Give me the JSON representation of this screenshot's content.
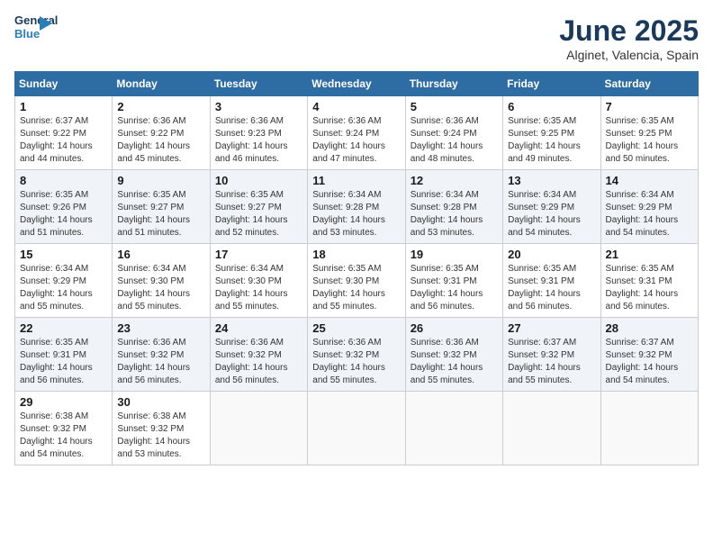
{
  "header": {
    "logo_line1": "General",
    "logo_line2": "Blue",
    "month_title": "June 2025",
    "location": "Alginet, Valencia, Spain"
  },
  "weekdays": [
    "Sunday",
    "Monday",
    "Tuesday",
    "Wednesday",
    "Thursday",
    "Friday",
    "Saturday"
  ],
  "weeks": [
    [
      {
        "day": "1",
        "sunrise": "6:37 AM",
        "sunset": "9:22 PM",
        "daylight": "14 hours and 44 minutes."
      },
      {
        "day": "2",
        "sunrise": "6:36 AM",
        "sunset": "9:22 PM",
        "daylight": "14 hours and 45 minutes."
      },
      {
        "day": "3",
        "sunrise": "6:36 AM",
        "sunset": "9:23 PM",
        "daylight": "14 hours and 46 minutes."
      },
      {
        "day": "4",
        "sunrise": "6:36 AM",
        "sunset": "9:24 PM",
        "daylight": "14 hours and 47 minutes."
      },
      {
        "day": "5",
        "sunrise": "6:36 AM",
        "sunset": "9:24 PM",
        "daylight": "14 hours and 48 minutes."
      },
      {
        "day": "6",
        "sunrise": "6:35 AM",
        "sunset": "9:25 PM",
        "daylight": "14 hours and 49 minutes."
      },
      {
        "day": "7",
        "sunrise": "6:35 AM",
        "sunset": "9:25 PM",
        "daylight": "14 hours and 50 minutes."
      }
    ],
    [
      {
        "day": "8",
        "sunrise": "6:35 AM",
        "sunset": "9:26 PM",
        "daylight": "14 hours and 51 minutes."
      },
      {
        "day": "9",
        "sunrise": "6:35 AM",
        "sunset": "9:27 PM",
        "daylight": "14 hours and 51 minutes."
      },
      {
        "day": "10",
        "sunrise": "6:35 AM",
        "sunset": "9:27 PM",
        "daylight": "14 hours and 52 minutes."
      },
      {
        "day": "11",
        "sunrise": "6:34 AM",
        "sunset": "9:28 PM",
        "daylight": "14 hours and 53 minutes."
      },
      {
        "day": "12",
        "sunrise": "6:34 AM",
        "sunset": "9:28 PM",
        "daylight": "14 hours and 53 minutes."
      },
      {
        "day": "13",
        "sunrise": "6:34 AM",
        "sunset": "9:29 PM",
        "daylight": "14 hours and 54 minutes."
      },
      {
        "day": "14",
        "sunrise": "6:34 AM",
        "sunset": "9:29 PM",
        "daylight": "14 hours and 54 minutes."
      }
    ],
    [
      {
        "day": "15",
        "sunrise": "6:34 AM",
        "sunset": "9:29 PM",
        "daylight": "14 hours and 55 minutes."
      },
      {
        "day": "16",
        "sunrise": "6:34 AM",
        "sunset": "9:30 PM",
        "daylight": "14 hours and 55 minutes."
      },
      {
        "day": "17",
        "sunrise": "6:34 AM",
        "sunset": "9:30 PM",
        "daylight": "14 hours and 55 minutes."
      },
      {
        "day": "18",
        "sunrise": "6:35 AM",
        "sunset": "9:30 PM",
        "daylight": "14 hours and 55 minutes."
      },
      {
        "day": "19",
        "sunrise": "6:35 AM",
        "sunset": "9:31 PM",
        "daylight": "14 hours and 56 minutes."
      },
      {
        "day": "20",
        "sunrise": "6:35 AM",
        "sunset": "9:31 PM",
        "daylight": "14 hours and 56 minutes."
      },
      {
        "day": "21",
        "sunrise": "6:35 AM",
        "sunset": "9:31 PM",
        "daylight": "14 hours and 56 minutes."
      }
    ],
    [
      {
        "day": "22",
        "sunrise": "6:35 AM",
        "sunset": "9:31 PM",
        "daylight": "14 hours and 56 minutes."
      },
      {
        "day": "23",
        "sunrise": "6:36 AM",
        "sunset": "9:32 PM",
        "daylight": "14 hours and 56 minutes."
      },
      {
        "day": "24",
        "sunrise": "6:36 AM",
        "sunset": "9:32 PM",
        "daylight": "14 hours and 56 minutes."
      },
      {
        "day": "25",
        "sunrise": "6:36 AM",
        "sunset": "9:32 PM",
        "daylight": "14 hours and 55 minutes."
      },
      {
        "day": "26",
        "sunrise": "6:36 AM",
        "sunset": "9:32 PM",
        "daylight": "14 hours and 55 minutes."
      },
      {
        "day": "27",
        "sunrise": "6:37 AM",
        "sunset": "9:32 PM",
        "daylight": "14 hours and 55 minutes."
      },
      {
        "day": "28",
        "sunrise": "6:37 AM",
        "sunset": "9:32 PM",
        "daylight": "14 hours and 54 minutes."
      }
    ],
    [
      {
        "day": "29",
        "sunrise": "6:38 AM",
        "sunset": "9:32 PM",
        "daylight": "14 hours and 54 minutes."
      },
      {
        "day": "30",
        "sunrise": "6:38 AM",
        "sunset": "9:32 PM",
        "daylight": "14 hours and 53 minutes."
      },
      null,
      null,
      null,
      null,
      null
    ]
  ]
}
